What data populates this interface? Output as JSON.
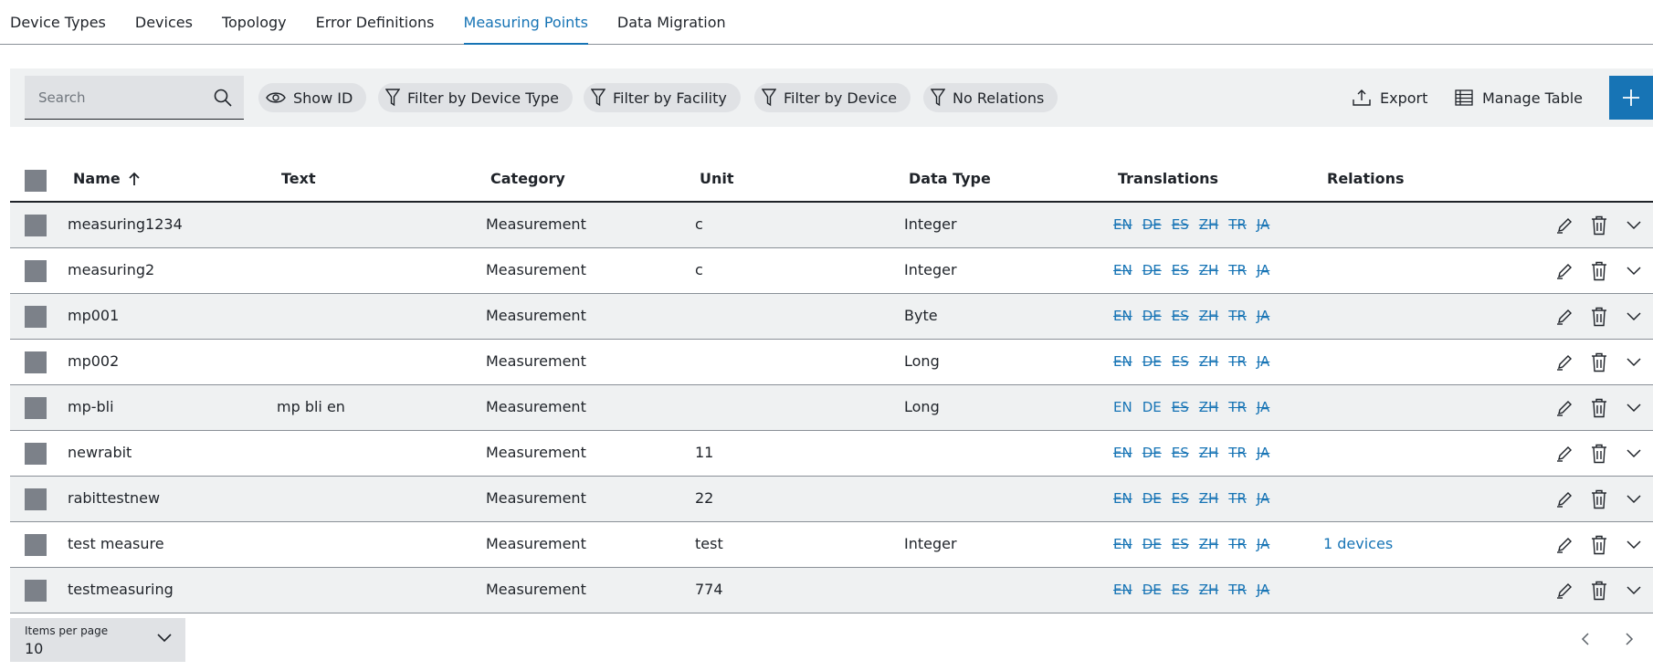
{
  "tabs": [
    {
      "label": "Device Types",
      "active": false
    },
    {
      "label": "Devices",
      "active": false
    },
    {
      "label": "Topology",
      "active": false
    },
    {
      "label": "Error Definitions",
      "active": false
    },
    {
      "label": "Measuring Points",
      "active": true
    },
    {
      "label": "Data Migration",
      "active": false
    }
  ],
  "toolbar": {
    "search_placeholder": "Search",
    "chips": {
      "show_id": "Show ID",
      "filter_device_type": "Filter by Device Type",
      "filter_facility": "Filter by Facility",
      "filter_device": "Filter by Device",
      "no_relations": "No Relations"
    },
    "export_label": "Export",
    "manage_table_label": "Manage Table",
    "add_icon": "plus-icon"
  },
  "table": {
    "columns": {
      "name": "Name",
      "text": "Text",
      "category": "Category",
      "unit": "Unit",
      "data_type": "Data Type",
      "translations": "Translations",
      "relations": "Relations"
    },
    "sort": {
      "column": "Name",
      "direction": "ascending",
      "icon": "arrow-up-icon"
    },
    "rows": [
      {
        "name": "measuring1234",
        "text": "",
        "category": "Measurement",
        "unit": "c",
        "data_type": "Integer",
        "relations": "",
        "translations": [
          {
            "code": "EN",
            "done": false
          },
          {
            "code": "DE",
            "done": false
          },
          {
            "code": "ES",
            "done": false
          },
          {
            "code": "ZH",
            "done": false
          },
          {
            "code": "TR",
            "done": false
          },
          {
            "code": "JA",
            "done": false
          }
        ]
      },
      {
        "name": "measuring2",
        "text": "",
        "category": "Measurement",
        "unit": "c",
        "data_type": "Integer",
        "relations": "",
        "translations": [
          {
            "code": "EN",
            "done": false
          },
          {
            "code": "DE",
            "done": false
          },
          {
            "code": "ES",
            "done": false
          },
          {
            "code": "ZH",
            "done": false
          },
          {
            "code": "TR",
            "done": false
          },
          {
            "code": "JA",
            "done": false
          }
        ]
      },
      {
        "name": "mp001",
        "text": "",
        "category": "Measurement",
        "unit": "",
        "data_type": "Byte",
        "relations": "",
        "translations": [
          {
            "code": "EN",
            "done": false
          },
          {
            "code": "DE",
            "done": false
          },
          {
            "code": "ES",
            "done": false
          },
          {
            "code": "ZH",
            "done": false
          },
          {
            "code": "TR",
            "done": false
          },
          {
            "code": "JA",
            "done": false
          }
        ]
      },
      {
        "name": "mp002",
        "text": "",
        "category": "Measurement",
        "unit": "",
        "data_type": "Long",
        "relations": "",
        "translations": [
          {
            "code": "EN",
            "done": false
          },
          {
            "code": "DE",
            "done": false
          },
          {
            "code": "ES",
            "done": false
          },
          {
            "code": "ZH",
            "done": false
          },
          {
            "code": "TR",
            "done": false
          },
          {
            "code": "JA",
            "done": false
          }
        ]
      },
      {
        "name": "mp-bli",
        "text": "mp bli en",
        "category": "Measurement",
        "unit": "",
        "data_type": "Long",
        "relations": "",
        "translations": [
          {
            "code": "EN",
            "done": true
          },
          {
            "code": "DE",
            "done": true
          },
          {
            "code": "ES",
            "done": false
          },
          {
            "code": "ZH",
            "done": false
          },
          {
            "code": "TR",
            "done": false
          },
          {
            "code": "JA",
            "done": false
          }
        ]
      },
      {
        "name": "newrabit",
        "text": "",
        "category": "Measurement",
        "unit": "11",
        "data_type": "",
        "relations": "",
        "translations": [
          {
            "code": "EN",
            "done": false
          },
          {
            "code": "DE",
            "done": false
          },
          {
            "code": "ES",
            "done": false
          },
          {
            "code": "ZH",
            "done": false
          },
          {
            "code": "TR",
            "done": false
          },
          {
            "code": "JA",
            "done": false
          }
        ]
      },
      {
        "name": "rabittestnew",
        "text": "",
        "category": "Measurement",
        "unit": "22",
        "data_type": "",
        "relations": "",
        "translations": [
          {
            "code": "EN",
            "done": false
          },
          {
            "code": "DE",
            "done": false
          },
          {
            "code": "ES",
            "done": false
          },
          {
            "code": "ZH",
            "done": false
          },
          {
            "code": "TR",
            "done": false
          },
          {
            "code": "JA",
            "done": false
          }
        ]
      },
      {
        "name": "test measure",
        "text": "",
        "category": "Measurement",
        "unit": "test",
        "data_type": "Integer",
        "relations": "1 devices",
        "translations": [
          {
            "code": "EN",
            "done": false
          },
          {
            "code": "DE",
            "done": false
          },
          {
            "code": "ES",
            "done": false
          },
          {
            "code": "ZH",
            "done": false
          },
          {
            "code": "TR",
            "done": false
          },
          {
            "code": "JA",
            "done": false
          }
        ]
      },
      {
        "name": "testmeasuring",
        "text": "",
        "category": "Measurement",
        "unit": "774",
        "data_type": "",
        "relations": "",
        "translations": [
          {
            "code": "EN",
            "done": false
          },
          {
            "code": "DE",
            "done": false
          },
          {
            "code": "ES",
            "done": false
          },
          {
            "code": "ZH",
            "done": false
          },
          {
            "code": "TR",
            "done": false
          },
          {
            "code": "JA",
            "done": false
          }
        ]
      }
    ]
  },
  "footer": {
    "items_per_page_label": "Items per page",
    "items_per_page_value": "10"
  },
  "colors": {
    "accent": "#1774b5",
    "row_alt": "#eff1f2",
    "checkbox": "#7c8189"
  }
}
